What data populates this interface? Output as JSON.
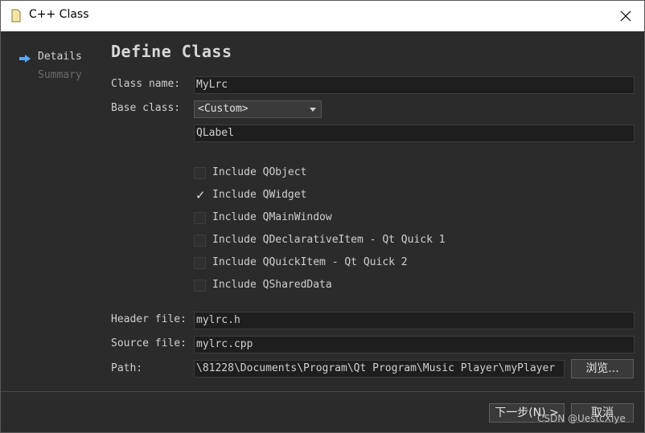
{
  "window": {
    "title": "C++ Class",
    "close_icon": "close-icon",
    "folder_icon": "file-icon"
  },
  "sidebar": {
    "items": [
      {
        "label": "Details",
        "active": true,
        "icon": "arrow-right-icon"
      },
      {
        "label": "Summary",
        "active": false
      }
    ]
  },
  "page": {
    "heading": "Define Class"
  },
  "form": {
    "class_name_label": "Class name:",
    "class_name_value": "MyLrc",
    "base_class_label": "Base class:",
    "base_class_selected": "<Custom>",
    "custom_base_value": "QLabel",
    "header_file_label": "Header file:",
    "header_file_value": "mylrc.h",
    "source_file_label": "Source file:",
    "source_file_value": "mylrc.cpp",
    "path_label": "Path:",
    "path_value": "\\81228\\Documents\\Program\\Qt Program\\Music Player\\myPlayer",
    "browse_label": "浏览..."
  },
  "includes": [
    {
      "label": "Include QObject",
      "checked": false
    },
    {
      "label": "Include QWidget",
      "checked": true
    },
    {
      "label": "Include QMainWindow",
      "checked": false
    },
    {
      "label": "Include QDeclarativeItem - Qt Quick 1",
      "checked": false
    },
    {
      "label": "Include QQuickItem - Qt Quick 2",
      "checked": false
    },
    {
      "label": "Include QSharedData",
      "checked": false
    }
  ],
  "footer": {
    "next_label": "下一步(N) >",
    "cancel_label": "取消",
    "watermark": "CSDN @UestcXiye"
  }
}
